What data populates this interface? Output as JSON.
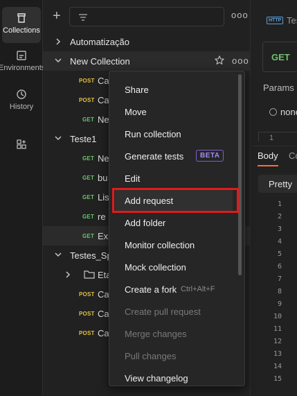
{
  "rail": {
    "items": [
      {
        "label": "Collections",
        "icon": "collections-icon",
        "active": true
      },
      {
        "label": "Environments",
        "icon": "environments-icon",
        "active": false
      },
      {
        "label": "History",
        "icon": "history-icon",
        "active": false
      },
      {
        "label": "",
        "icon": "configure-workbench-icon",
        "active": false
      }
    ]
  },
  "sidebar": {
    "more": "ooo",
    "tree": {
      "automatizacao": "Automatização",
      "new_collection": "New Collection",
      "nc_items": [
        {
          "method": "POST",
          "name": "Ca"
        },
        {
          "method": "POST",
          "name": "Ca"
        },
        {
          "method": "GET",
          "name": "Ne"
        }
      ],
      "teste1": "Teste1",
      "t1_items": [
        {
          "method": "GET",
          "name": "Ne"
        },
        {
          "method": "GET",
          "name": "bu"
        },
        {
          "method": "GET",
          "name": "Lis"
        },
        {
          "method": "GET",
          "name": "re"
        },
        {
          "method": "GET",
          "name": "Ex"
        }
      ],
      "testes_sp": "Testes_Sp",
      "folder_eta": "Eta",
      "ts_items": [
        {
          "method": "POST",
          "name": "Ca"
        },
        {
          "method": "POST",
          "name": "Ca"
        },
        {
          "method": "POST",
          "name": "Ca"
        }
      ]
    }
  },
  "main": {
    "tab_badge": "HTTP",
    "tab_title": "Tes",
    "method": "GET",
    "params": "Params",
    "none": "none",
    "first_line": "1",
    "body_tab": "Body",
    "co_tab": "Co",
    "pretty": "Pretty",
    "lines": [
      "1",
      "2",
      "3",
      "4",
      "5",
      "6",
      "7",
      "8",
      "9",
      "10",
      "11",
      "12",
      "13",
      "14",
      "15"
    ]
  },
  "menu": {
    "items": [
      {
        "label": "Share",
        "disabled": false
      },
      {
        "label": "Move",
        "disabled": false
      },
      {
        "label": "Run collection",
        "disabled": false
      },
      {
        "label": "Generate tests",
        "disabled": false,
        "badge": "BETA"
      },
      {
        "label": "Edit",
        "disabled": false
      },
      {
        "label": "Add request",
        "disabled": false,
        "selected": true
      },
      {
        "label": "Add folder",
        "disabled": false
      },
      {
        "label": "Monitor collection",
        "disabled": false
      },
      {
        "label": "Mock collection",
        "disabled": false
      },
      {
        "label": "Create a fork",
        "disabled": false,
        "shortcut": "Ctrl+Alt+F"
      },
      {
        "label": "Create pull request",
        "disabled": true
      },
      {
        "label": "Merge changes",
        "disabled": true
      },
      {
        "label": "Pull changes",
        "disabled": true
      },
      {
        "label": "View changelog",
        "disabled": false
      }
    ]
  },
  "colors": {
    "post": "#e2c043",
    "get": "#6bc46d",
    "accent": "#ff6c37",
    "highlight": "#e01b1b",
    "beta": "#7e5cd3"
  }
}
